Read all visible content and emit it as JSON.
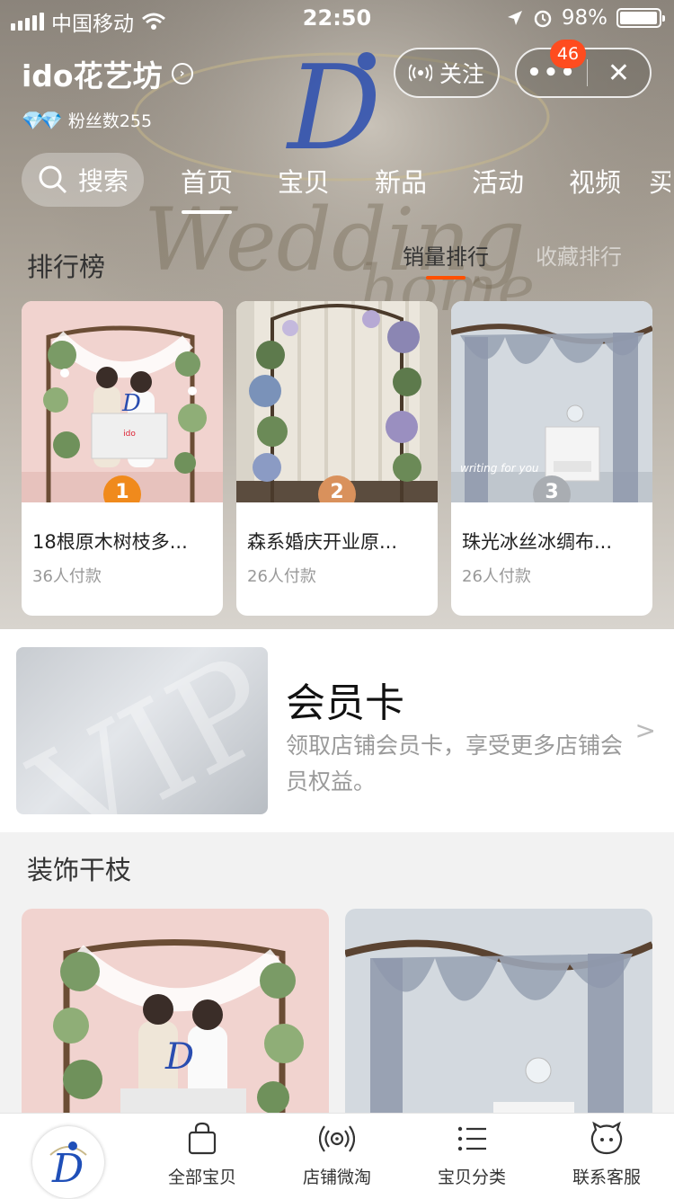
{
  "status_bar": {
    "carrier": "中国移动",
    "time": "22:50",
    "battery": "98%",
    "battery_level": 0.98
  },
  "shop": {
    "name": "ido花艺坊",
    "fans": "粉丝数255"
  },
  "header": {
    "follow_label": "关注",
    "notification_count": "46"
  },
  "nav": {
    "search_label": "搜索",
    "tabs": [
      "首页",
      "宝贝",
      "新品",
      "活动",
      "视频",
      "买"
    ],
    "active_tab": "首页"
  },
  "ranking": {
    "title": "排行榜",
    "tabs": [
      "销量排行",
      "收藏排行"
    ],
    "items": [
      {
        "rank": "1",
        "name": "18根原木树枝多...",
        "sales": "36人付款",
        "medal_color": "#f08a1c"
      },
      {
        "rank": "2",
        "name": "森系婚庆开业原...",
        "sales": "26人付款",
        "medal_color": "#d9915c"
      },
      {
        "rank": "3",
        "name": "珠光冰丝冰绸布...",
        "sales": "26人付款",
        "medal_color": "#a9adb2"
      }
    ]
  },
  "member_card": {
    "title": "会员卡",
    "description": "领取店铺会员卡，享受更多店铺会员权益。",
    "watermark": "VIP"
  },
  "category": {
    "title": "装饰干枝"
  },
  "bottom_bar": {
    "items": [
      "全部宝贝",
      "店铺微淘",
      "宝贝分类",
      "联系客服"
    ]
  },
  "colors": {
    "accent": "#ff5000",
    "badge": "#ff4c1f",
    "logo_blue": "#1f4fb8"
  }
}
